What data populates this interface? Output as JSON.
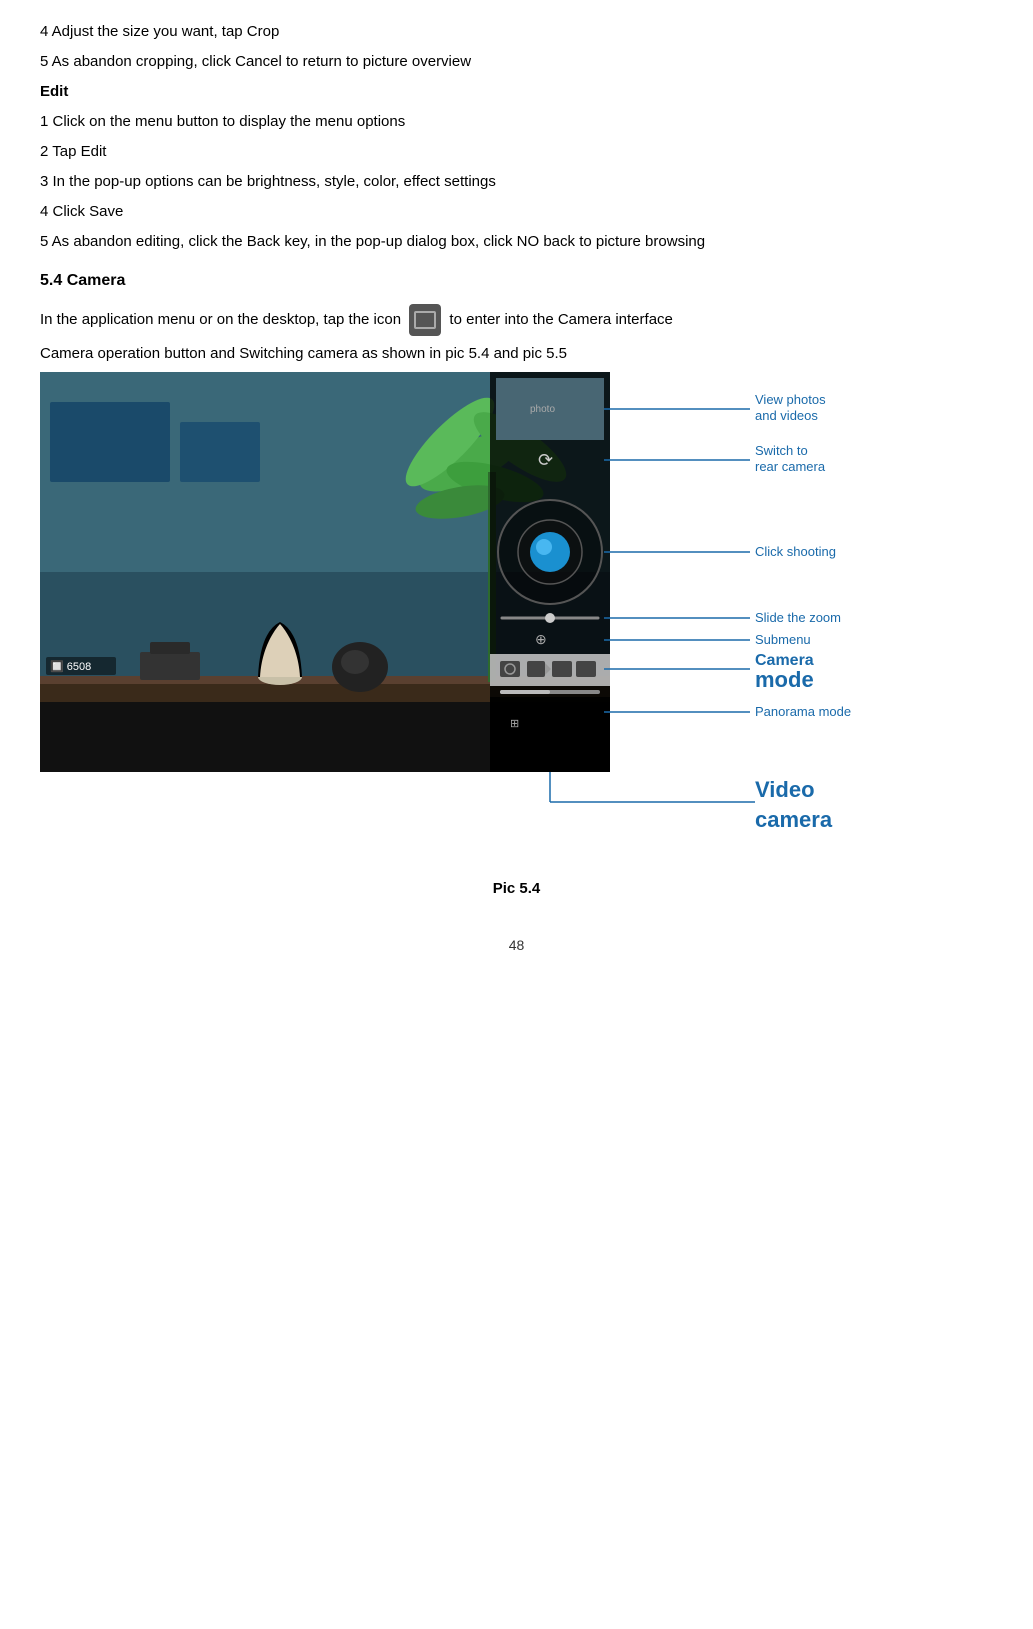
{
  "content": {
    "line1": "4 Adjust the size you want, tap Crop",
    "line2": "5 As abandon cropping, click Cancel to return to picture overview",
    "edit_heading": "Edit",
    "edit_line1": "1 Click on the menu button to display the menu options",
    "edit_line2": "2 Tap Edit",
    "edit_line3": "3 In the pop-up options can be brightness, style, color, effect settings",
    "edit_line4": "4 Click Save",
    "edit_line5": "5 As abandon editing, click the Back key, in the pop-up dialog box, click NO back to picture browsing"
  },
  "section": {
    "title": "5.4 Camera",
    "intro1": "In the application menu or on the desktop, tap the icon",
    "intro2": "to enter into the Camera interface",
    "intro3": "Camera operation button and Switching camera as shown in pic 5.4 and pic 5.5"
  },
  "annotations": {
    "view_photos": "View  photos\nand videos",
    "switch_camera": "Switch to\nrear camera",
    "click_shooting": "Click shooting",
    "slide_zoom": "Slide the zoom",
    "submenu": "Submenu",
    "camera_mode_label": "Camera",
    "camera_mode_word": "mode",
    "panorama_mode": "Panorama  mode",
    "video_camera_label": "Video\ncamera"
  },
  "camera_ui": {
    "number": "🔲 6508"
  },
  "caption": "Pic 5.4",
  "page_number": "48"
}
